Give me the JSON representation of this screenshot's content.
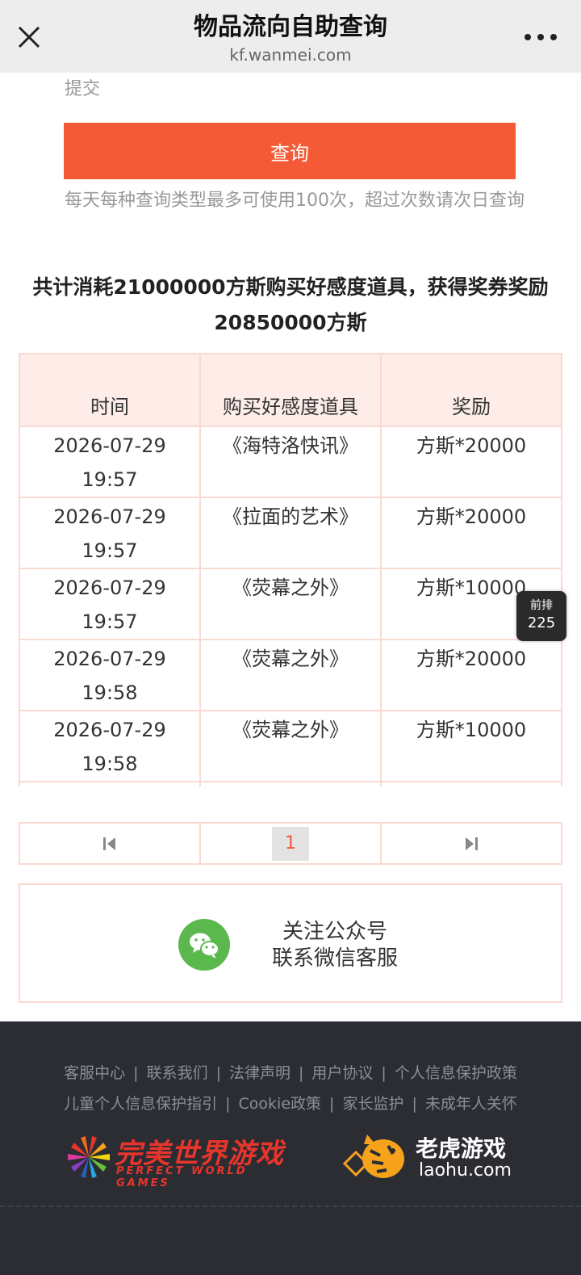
{
  "header": {
    "title": "物品流向自助查询",
    "domain": "kf.wanmei.com",
    "close_icon": "close-icon",
    "more_icon": "more-dots-icon"
  },
  "form": {
    "submit_label": "提交",
    "query_button": "查询",
    "note": "每天每种查询类型最多可使用100次，超过次数请次日查询"
  },
  "summary": "共计消耗21000000方斯购买好感度道具，获得奖券奖励20850000方斯",
  "table": {
    "headers": [
      "时间",
      "购买好感度道具",
      "奖励"
    ],
    "rows": [
      {
        "time": "2026-07-29 19:57",
        "item": "《海特洛快讯》",
        "reward": "方斯*20000"
      },
      {
        "time": "2026-07-29 19:57",
        "item": "《拉面的艺术》",
        "reward": "方斯*20000"
      },
      {
        "time": "2026-07-29 19:57",
        "item": "《荧幕之外》",
        "reward": "方斯*10000"
      },
      {
        "time": "2026-07-29 19:58",
        "item": "《荧幕之外》",
        "reward": "方斯*20000"
      },
      {
        "time": "2026-07-29 19:58",
        "item": "《荧幕之外》",
        "reward": "方斯*10000"
      }
    ]
  },
  "float_badge": {
    "label": "前排",
    "count": "225"
  },
  "pager": {
    "current_page": "1",
    "first_icon": "first-page-icon",
    "last_icon": "last-page-icon"
  },
  "wechat": {
    "line1": "关注公众号",
    "line2": "联系微信客服",
    "icon": "wechat-icon"
  },
  "footer": {
    "links_row1": [
      "客服中心",
      "联系我们",
      "法律声明",
      "用户协议",
      "个人信息保护政策"
    ],
    "links_row2": [
      "儿童个人信息保护指引",
      "Cookie政策",
      "家长监护",
      "未成年人关怀"
    ],
    "logo1_cn": "完美世界游戏",
    "logo1_en": "PERFECT WORLD GAMES",
    "logo2_cn": "老虎游戏",
    "logo2_en": "laohu.com"
  },
  "colors": {
    "accent": "#f35a35",
    "table_border": "#fbd9d3",
    "footer_bg": "#2b2d33"
  }
}
